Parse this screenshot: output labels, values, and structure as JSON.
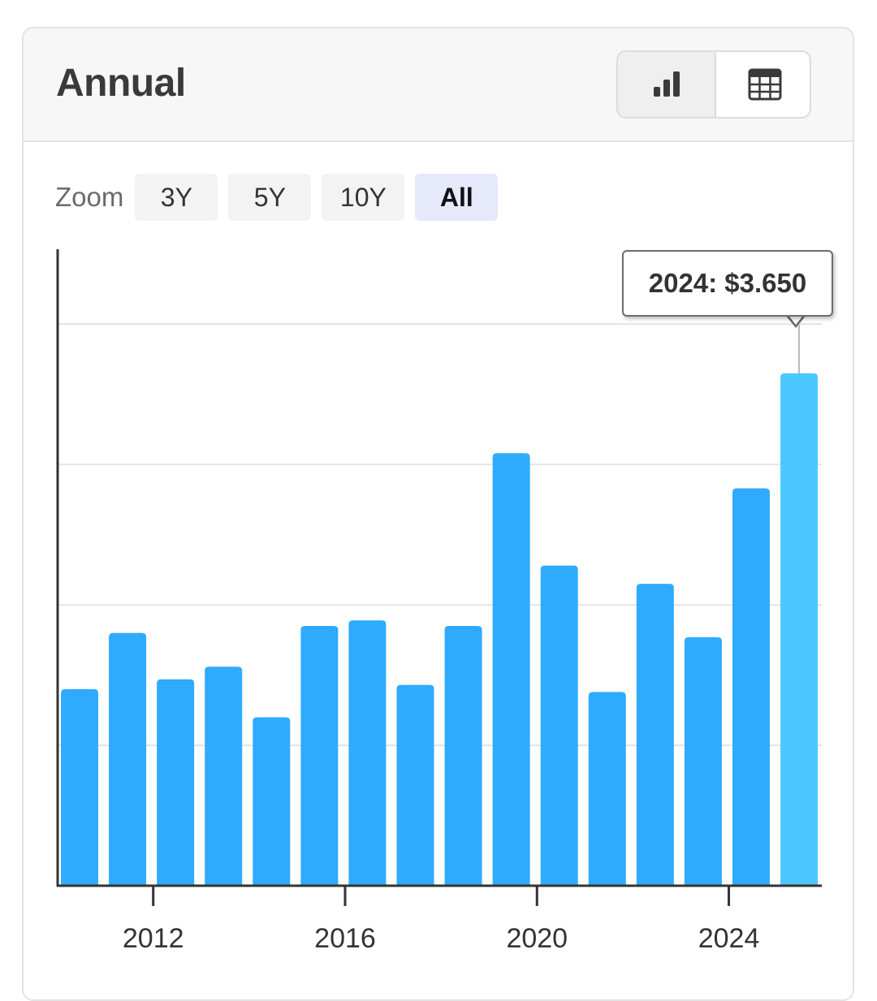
{
  "header": {
    "title": "Annual",
    "chart_view_icon": "bar-chart-icon",
    "table_view_icon": "table-grid-icon"
  },
  "zoom": {
    "label": "Zoom",
    "options": [
      "3Y",
      "5Y",
      "10Y",
      "All"
    ],
    "selected": "All"
  },
  "colors": {
    "bar": "#2fabfd",
    "bar_highlight": "#4cc8fe",
    "zoom_active_bg": "#e6e9fb"
  },
  "tooltip": {
    "text": "2024: $3.650"
  },
  "chart_data": {
    "type": "bar",
    "x": [
      2010,
      2011,
      2012,
      2013,
      2014,
      2015,
      2016,
      2017,
      2018,
      2019,
      2020,
      2021,
      2022,
      2023,
      2024
    ],
    "values": [
      1.4,
      1.8,
      1.47,
      1.56,
      1.2,
      1.85,
      1.89,
      1.43,
      1.85,
      3.08,
      2.28,
      1.38,
      2.15,
      1.77,
      2.83,
      3.65
    ],
    "xtick_labels": [
      "2012",
      "2016",
      "2020",
      "2024"
    ],
    "xticks": [
      2012,
      2016,
      2020,
      2024
    ],
    "ylim": [
      0,
      4.4
    ],
    "ygrid": [
      1,
      2,
      3,
      4
    ],
    "grid": "horizontal",
    "highlighted": 2024,
    "title": "",
    "xlabel": "",
    "ylabel": ""
  }
}
